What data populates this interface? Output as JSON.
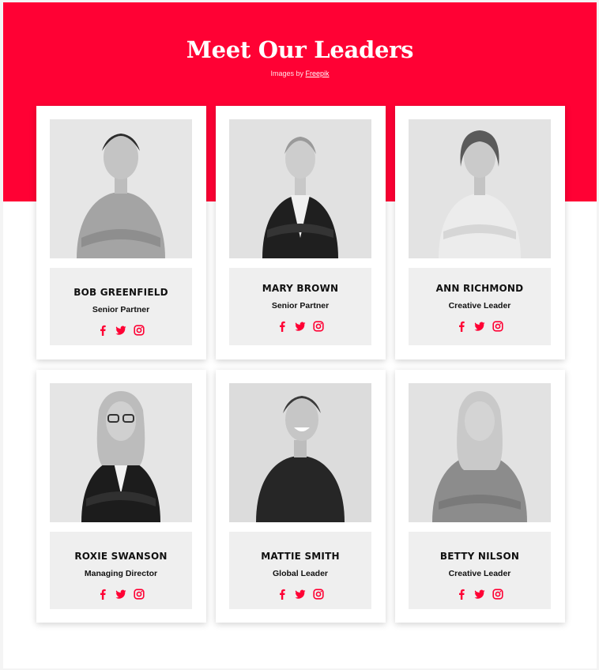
{
  "header": {
    "title": "Meet Our Leaders",
    "credit_prefix": "Images by",
    "credit_link": "Freepik"
  },
  "colors": {
    "accent": "#ff0134",
    "card_info_bg": "#efefef"
  },
  "icons": [
    "facebook-icon",
    "twitter-icon",
    "instagram-icon"
  ],
  "leaders": [
    {
      "name": "BOB GREENFIELD",
      "role": "Senior Partner"
    },
    {
      "name": "MARY BROWN",
      "role": "Senior Partner"
    },
    {
      "name": "ANN RICHMOND",
      "role": "Creative Leader"
    },
    {
      "name": "ROXIE SWANSON",
      "role": "Managing Director"
    },
    {
      "name": "MATTIE SMITH",
      "role": "Global Leader"
    },
    {
      "name": "BETTY NILSON",
      "role": "Creative Leader"
    }
  ]
}
